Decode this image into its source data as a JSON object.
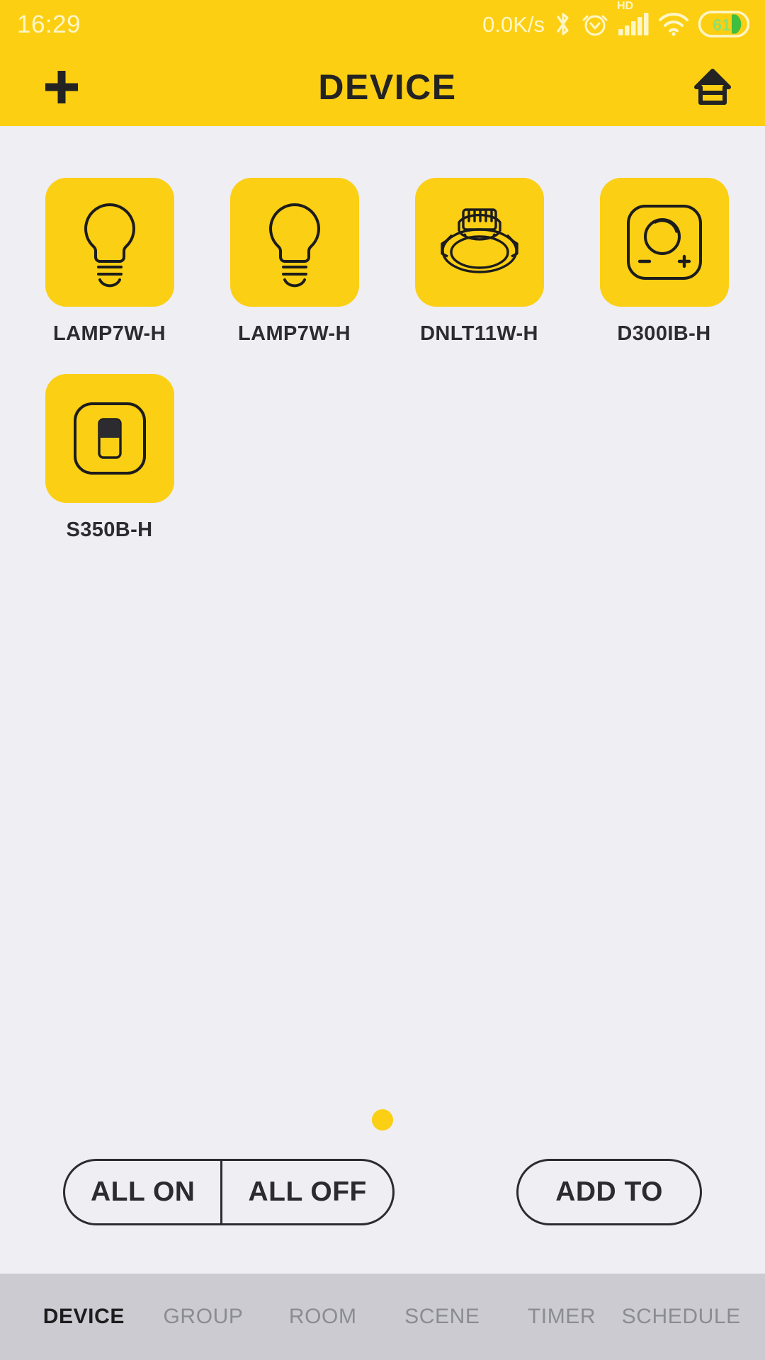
{
  "statusbar": {
    "time": "16:29",
    "net_speed": "0.0K/s",
    "hd_label": "HD",
    "battery_percent": "61",
    "icons": [
      "bluetooth-icon",
      "alarm-icon",
      "signal-icon",
      "wifi-icon",
      "battery-icon"
    ]
  },
  "header": {
    "title": "DEVICE",
    "add_icon": "plus-icon",
    "home_icon": "home-icon"
  },
  "devices": [
    {
      "label": "LAMP7W-H",
      "icon": "bulb-icon"
    },
    {
      "label": "LAMP7W-H",
      "icon": "bulb-icon"
    },
    {
      "label": "DNLT11W-H",
      "icon": "downlight-icon"
    },
    {
      "label": "D300IB-H",
      "icon": "dimmer-icon"
    },
    {
      "label": "S350B-H",
      "icon": "switch-icon"
    }
  ],
  "pager": {
    "dots": 1,
    "active": 0
  },
  "actions": {
    "all_on": "ALL ON",
    "all_off": "ALL OFF",
    "add_to": "ADD TO"
  },
  "tabs": [
    {
      "label": "DEVICE",
      "active": true
    },
    {
      "label": "GROUP",
      "active": false
    },
    {
      "label": "ROOM",
      "active": false
    },
    {
      "label": "SCENE",
      "active": false
    },
    {
      "label": "TIMER",
      "active": false
    },
    {
      "label": "SCHEDULE",
      "active": false
    }
  ],
  "colors": {
    "brand_yellow": "#FCCF12",
    "tile_yellow": "#FBCF14",
    "background": "#EFEEF3",
    "tabbar": "#CBCBD1",
    "ink": "#2B2B30",
    "battery_green": "#3FBE3F"
  }
}
